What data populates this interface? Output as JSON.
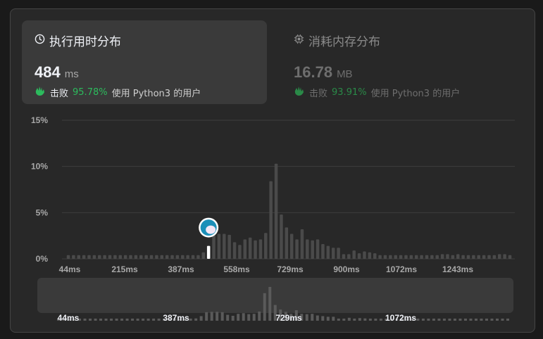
{
  "runtime_card": {
    "title": "执行用时分布",
    "value": "484",
    "unit": "ms",
    "beat_label": "击败",
    "beat_pct": "95.78%",
    "beat_suffix": "使用 Python3 的用户",
    "icon": "clock-icon"
  },
  "memory_card": {
    "title": "消耗内存分布",
    "value": "16.78",
    "unit": "MB",
    "beat_label": "击败",
    "beat_pct": "93.91%",
    "beat_suffix": "使用 Python3 的用户",
    "icon": "chip-icon"
  },
  "colors": {
    "accent_green": "#2cbb5d",
    "bar": "#4a4a4a",
    "highlight_bar": "#ffffff",
    "grid": "#3e3e3e"
  },
  "chart_data": {
    "type": "bar",
    "ylabels": [
      "15%",
      "10%",
      "5%",
      "0%"
    ],
    "yticks": [
      15,
      10,
      5,
      0
    ],
    "ylim": [
      0,
      15
    ],
    "xtick_labels": [
      "44ms",
      "215ms",
      "387ms",
      "558ms",
      "729ms",
      "900ms",
      "1072ms",
      "1243ms"
    ],
    "highlight_index": 27,
    "values": [
      0.4,
      0.4,
      0.4,
      0.4,
      0.4,
      0.4,
      0.4,
      0.4,
      0.4,
      0.4,
      0.4,
      0.4,
      0.4,
      0.4,
      0.4,
      0.4,
      0.4,
      0.4,
      0.4,
      0.4,
      0.4,
      0.4,
      0.4,
      0.4,
      0.4,
      0.4,
      0.7,
      1.4,
      2.6,
      2.7,
      2.7,
      2.6,
      1.8,
      1.5,
      2.1,
      2.3,
      2.0,
      2.1,
      2.8,
      8.4,
      10.3,
      4.8,
      3.4,
      2.7,
      2.1,
      3.2,
      2.1,
      2.0,
      2.1,
      1.6,
      1.4,
      1.2,
      1.2,
      0.5,
      0.5,
      0.9,
      0.6,
      0.8,
      0.7,
      0.6,
      0.4,
      0.4,
      0.4,
      0.4,
      0.4,
      0.4,
      0.4,
      0.4,
      0.4,
      0.4,
      0.4,
      0.4,
      0.5,
      0.5,
      0.4,
      0.5,
      0.4,
      0.4,
      0.4,
      0.4,
      0.4,
      0.4,
      0.4,
      0.5,
      0.5,
      0.4
    ],
    "navigator_labels": [
      "44ms",
      "387ms",
      "729ms",
      "1072ms"
    ]
  }
}
